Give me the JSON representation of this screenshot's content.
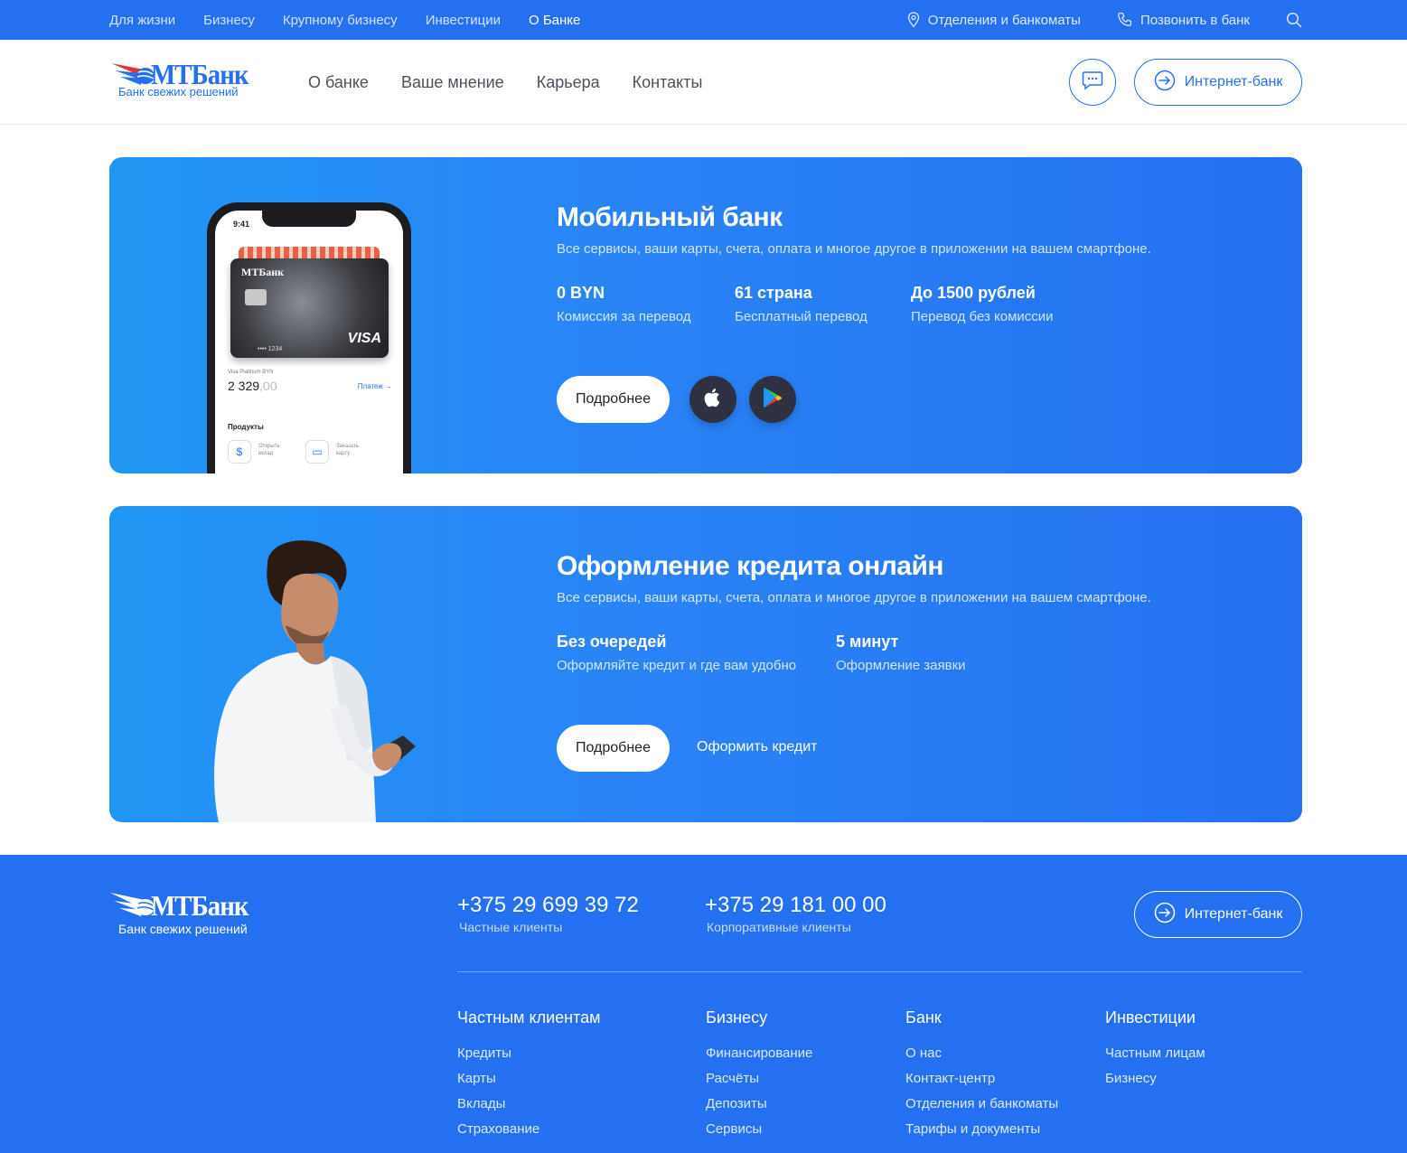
{
  "topbar": {
    "links": [
      "Для жизни",
      "Бизнесу",
      "Крупному бизнесу",
      "Инвестиции",
      "О Банке"
    ],
    "branches": "Отделения и банкоматы",
    "call": "Позвонить в банк"
  },
  "header": {
    "logo_name": "МТБанк",
    "logo_tagline": "Банк свежих решений",
    "nav": [
      "О банке",
      "Ваше мнение",
      "Карьера",
      "Контакты"
    ],
    "internet_bank": "Интернет-банк"
  },
  "mobile_bank": {
    "title": "Мобильный банк",
    "subtitle": "Все сервисы, ваши карты, счета, оплата и многое другое в приложении на вашем смартфоне.",
    "stats": [
      {
        "value": "0 BYN",
        "label": "Комиссия за перевод"
      },
      {
        "value": "61 страна",
        "label": "Бесплатный перевод"
      },
      {
        "value": "До 1500 рублей",
        "label": "Перевод без комиссии"
      }
    ],
    "more_button": "Подробнее",
    "phone": {
      "time": "9:41",
      "card_logo": "МТБанк",
      "card_number": "•••• 1234",
      "card_brand": "VISA",
      "card_type": "Visa Platinum BYN",
      "balance_int": "2 329",
      "balance_dec": ",00",
      "payment": "Платеж",
      "products": "Продукты",
      "open_deposit": "Открыть вклад",
      "order_card": "Заказать карту"
    }
  },
  "credit": {
    "title": "Оформление кредита онлайн",
    "subtitle": "Все сервисы, ваши карты, счета, оплата и многое другое в приложении на вашем смартфоне.",
    "stats": [
      {
        "value": "Без очередей",
        "label": "Оформляйте кредит и где вам удобно"
      },
      {
        "value": "5 минут",
        "label": "Оформление заявки"
      }
    ],
    "more_button": "Подробнее",
    "apply_link": "Оформить кредит"
  },
  "footer": {
    "logo_name": "МТБанк",
    "logo_tagline": "Банк свежих решений",
    "phones": [
      {
        "number": "+375 29 699 39 72",
        "desc": "Частные клиенты"
      },
      {
        "number": "+375 29 181 00 00",
        "desc": "Корпоративные клиенты"
      }
    ],
    "internet_bank": "Интернет-банк",
    "columns": [
      {
        "title": "Частным клиентам",
        "items": [
          "Кредиты",
          "Карты",
          "Вклады",
          "Страхование"
        ]
      },
      {
        "title": "Бизнесу",
        "items": [
          "Финансирование",
          "Расчёты",
          "Депозиты",
          "Сервисы"
        ]
      },
      {
        "title": "Банк",
        "items": [
          "О нас",
          "Контакт-центр",
          "Отделения и банкоматы",
          "Тарифы и документы"
        ]
      },
      {
        "title": "Инвестиции",
        "items": [
          "Частным лицам",
          "Бизнесу"
        ]
      }
    ]
  },
  "colors": {
    "brand": "#2470f0",
    "card_gradient_start": "#2196f3",
    "store_button": "#2d3142"
  },
  "icons": [
    "location-pin-icon",
    "phone-icon",
    "search-icon",
    "chat-icon",
    "login-arrow-icon",
    "apple-icon",
    "google-play-icon",
    "dollar-icon",
    "card-icon",
    "arrow-right-icon"
  ]
}
